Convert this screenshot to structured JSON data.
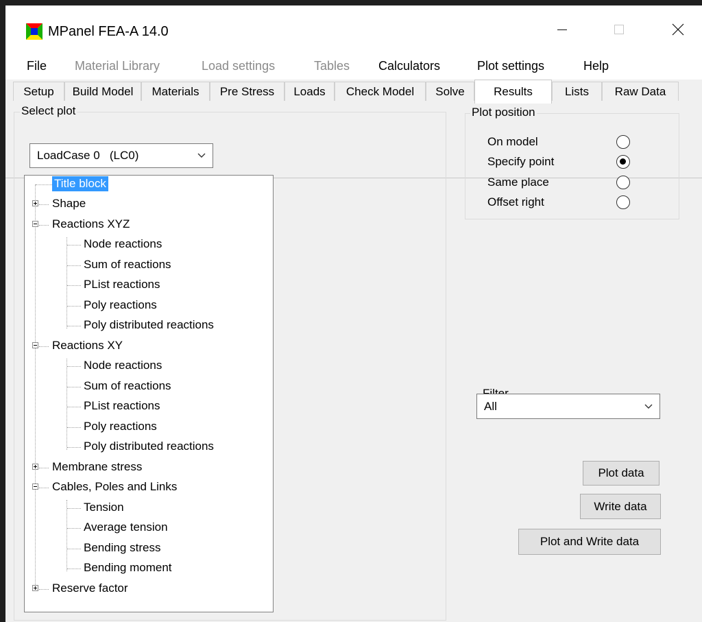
{
  "window": {
    "title": "MPanel FEA-A 14.0",
    "controls": {
      "minimize": "minimize-icon",
      "maximize": "maximize-icon",
      "close": "close-icon"
    }
  },
  "menu": [
    {
      "label": "File",
      "enabled": true
    },
    {
      "label": "Material Library",
      "enabled": false
    },
    {
      "label": "Load settings",
      "enabled": false
    },
    {
      "label": "Tables",
      "enabled": false
    },
    {
      "label": "Calculators",
      "enabled": true
    },
    {
      "label": "Plot settings",
      "enabled": true
    },
    {
      "label": "Help",
      "enabled": true
    }
  ],
  "tabs": [
    {
      "label": "Setup",
      "active": false
    },
    {
      "label": "Build Model",
      "active": false
    },
    {
      "label": "Materials",
      "active": false
    },
    {
      "label": "Pre Stress",
      "active": false
    },
    {
      "label": "Loads",
      "active": false
    },
    {
      "label": "Check Model",
      "active": false
    },
    {
      "label": "Solve",
      "active": false
    },
    {
      "label": "Results",
      "active": true
    },
    {
      "label": "Lists",
      "active": false
    },
    {
      "label": "Raw Data",
      "active": false
    }
  ],
  "select_plot": {
    "group_label": "Select plot",
    "loadcase_value": "LoadCase 0   (LC0)",
    "tree": [
      {
        "label": "Title block",
        "level": 0,
        "expander": "none",
        "selected": true
      },
      {
        "label": "Shape",
        "level": 0,
        "expander": "plus"
      },
      {
        "label": "Reactions XYZ",
        "level": 0,
        "expander": "minus"
      },
      {
        "label": "Node reactions",
        "level": 1
      },
      {
        "label": "Sum of reactions",
        "level": 1
      },
      {
        "label": "PList reactions",
        "level": 1
      },
      {
        "label": "Poly reactions",
        "level": 1
      },
      {
        "label": "Poly distributed reactions",
        "level": 1,
        "last": true
      },
      {
        "label": "Reactions XY",
        "level": 0,
        "expander": "minus"
      },
      {
        "label": "Node reactions",
        "level": 1
      },
      {
        "label": "Sum of reactions",
        "level": 1
      },
      {
        "label": "PList reactions",
        "level": 1
      },
      {
        "label": "Poly reactions",
        "level": 1
      },
      {
        "label": "Poly distributed reactions",
        "level": 1,
        "last": true
      },
      {
        "label": "Membrane stress",
        "level": 0,
        "expander": "plus"
      },
      {
        "label": "Cables, Poles and Links",
        "level": 0,
        "expander": "minus"
      },
      {
        "label": "Tension",
        "level": 1
      },
      {
        "label": "Average tension",
        "level": 1
      },
      {
        "label": "Bending stress",
        "level": 1
      },
      {
        "label": "Bending moment",
        "level": 1,
        "last": true
      },
      {
        "label": "Reserve factor",
        "level": 0,
        "expander": "plus"
      }
    ]
  },
  "plot_position": {
    "group_label": "Plot position",
    "options": [
      {
        "label": "On model",
        "checked": false
      },
      {
        "label": "Specify point",
        "checked": true
      },
      {
        "label": "Same place",
        "checked": false
      },
      {
        "label": "Offset right",
        "checked": false
      }
    ]
  },
  "filter": {
    "label": "Filter",
    "value": "All"
  },
  "buttons": {
    "plot": "Plot data",
    "write": "Write data",
    "plot_write": "Plot and Write data"
  }
}
